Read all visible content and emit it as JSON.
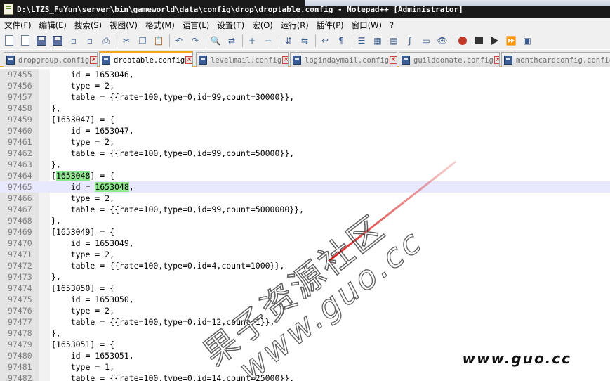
{
  "window": {
    "title": "D:\\LTZS_FuYun\\server\\bin\\gameworld\\data\\config\\drop\\droptable.config - Notepad++ [Administrator]"
  },
  "menu": [
    "文件(F)",
    "编辑(E)",
    "搜索(S)",
    "视图(V)",
    "格式(M)",
    "语言(L)",
    "设置(T)",
    "宏(O)",
    "运行(R)",
    "插件(P)",
    "窗口(W)",
    "?"
  ],
  "toolbar": {
    "buttons": [
      "new-file-icon",
      "open-file-icon",
      "save-icon",
      "save-all-icon",
      "close-icon",
      "close-all-icon",
      "print-icon",
      "cut-icon",
      "copy-icon",
      "paste-icon",
      "undo-icon",
      "redo-icon",
      "find-icon",
      "replace-icon",
      "zoom-in-icon",
      "zoom-out-icon",
      "sync-v-icon",
      "sync-h-icon",
      "word-wrap-icon",
      "show-all-chars-icon",
      "indent-guide-icon",
      "udl-icon",
      "doc-map-icon",
      "function-list-icon",
      "folder-workspace-icon",
      "monitor-icon",
      "record-macro-icon",
      "stop-macro-icon",
      "play-macro-icon",
      "run-macro-multiple-icon",
      "save-macro-icon"
    ]
  },
  "tabs": [
    {
      "label": "dropgroup.config",
      "active": false
    },
    {
      "label": "droptable.config",
      "active": true
    },
    {
      "label": "levelmail.config",
      "active": false
    },
    {
      "label": "logindaymail.config",
      "active": false
    },
    {
      "label": "guilddonate.config",
      "active": false
    },
    {
      "label": "monthcardconfig.config",
      "active": false
    }
  ],
  "editor": {
    "highlight_word": "1653048",
    "lines": [
      {
        "n": "97455",
        "text": "    id = 1653046,"
      },
      {
        "n": "97456",
        "text": "    type = 2,"
      },
      {
        "n": "97457",
        "text": "    table = {{rate=100,type=0,id=99,count=30000}},"
      },
      {
        "n": "97458",
        "text": "},"
      },
      {
        "n": "97459",
        "text": "[1653047] = {"
      },
      {
        "n": "97460",
        "text": "    id = 1653047,"
      },
      {
        "n": "97461",
        "text": "    type = 2,"
      },
      {
        "n": "97462",
        "text": "    table = {{rate=100,type=0,id=99,count=50000}},"
      },
      {
        "n": "97463",
        "text": "},"
      },
      {
        "n": "97464",
        "text": "[1653048] = {"
      },
      {
        "n": "97465",
        "text": "    id = 1653048,"
      },
      {
        "n": "97466",
        "text": "    type = 2,"
      },
      {
        "n": "97467",
        "text": "    table = {{rate=100,type=0,id=99,count=5000000}},"
      },
      {
        "n": "97468",
        "text": "},"
      },
      {
        "n": "97469",
        "text": "[1653049] = {"
      },
      {
        "n": "97470",
        "text": "    id = 1653049,"
      },
      {
        "n": "97471",
        "text": "    type = 2,"
      },
      {
        "n": "97472",
        "text": "    table = {{rate=100,type=0,id=4,count=1000}},"
      },
      {
        "n": "97473",
        "text": "},"
      },
      {
        "n": "97474",
        "text": "[1653050] = {"
      },
      {
        "n": "97475",
        "text": "    id = 1653050,"
      },
      {
        "n": "97476",
        "text": "    type = 2,"
      },
      {
        "n": "97477",
        "text": "    table = {{rate=100,type=0,id=12,count=1}},"
      },
      {
        "n": "97478",
        "text": "},"
      },
      {
        "n": "97479",
        "text": "[1653051] = {"
      },
      {
        "n": "97480",
        "text": "    id = 1653051,"
      },
      {
        "n": "97481",
        "text": "    type = 1,"
      },
      {
        "n": "97482",
        "text": "    table = {{rate=100,type=0,id=14,count=25000}},"
      }
    ],
    "current_line_index": 10
  },
  "watermarks": {
    "chinese": "果子资源社区",
    "url": "www.guo.cc",
    "corner": "www.guo.cc"
  }
}
